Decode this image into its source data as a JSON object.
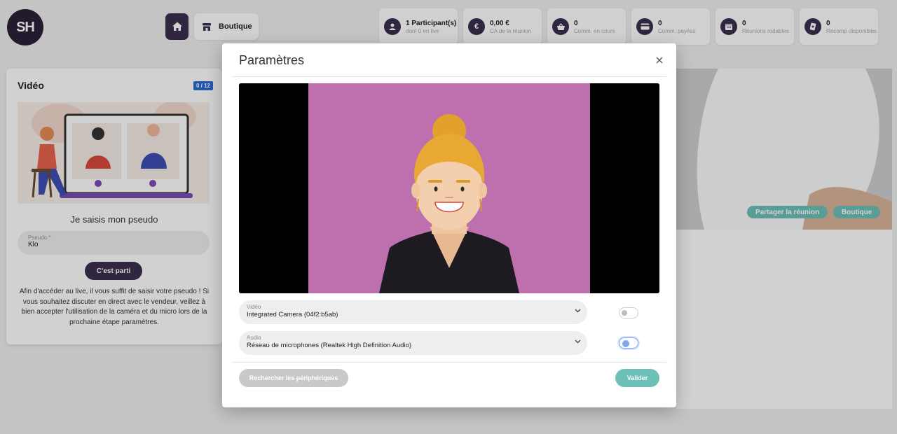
{
  "app": {
    "logo_text": "SH"
  },
  "topnav": {
    "home_label": "",
    "boutique_label": "Boutique"
  },
  "stats": [
    {
      "value": "1 Participant(s)",
      "label": "dont 0 en live",
      "icon": "user-icon"
    },
    {
      "value": "0,00 €",
      "label": "CA de la réunion",
      "icon": "euro-icon"
    },
    {
      "value": "0",
      "label": "Comm. en cours",
      "icon": "basket-icon"
    },
    {
      "value": "0",
      "label": "Comm. payées",
      "icon": "card-icon"
    },
    {
      "value": "0",
      "label": "Réunions rodables",
      "icon": "calendar-icon"
    },
    {
      "value": "0",
      "label": "Récomp disponibles",
      "icon": "reward-icon"
    }
  ],
  "video_card": {
    "title": "Vidéo",
    "badge": "0 / 12",
    "pseudo_heading": "Je saisis mon pseudo",
    "pseudo_label": "Pseudo *",
    "pseudo_value": "Klo",
    "go_button": "C'est parti",
    "help_text": "Afin d'accéder au live, il vous suffit de saisir votre pseudo ! Si vous souhaitez discuter en direct avec le vendeur, veillez à bien accepter l'utilisation de la caméra et du micro lors de la prochaine étape paramètres."
  },
  "side_actions": {
    "share": "Partager la réunion",
    "boutique": "Boutique"
  },
  "modal": {
    "title": "Paramètres",
    "video_label": "Vidéo",
    "video_value": "Integrated Camera (04f2:b5ab)",
    "video_enabled": false,
    "audio_label": "Audio",
    "audio_value": "Réseau de microphones (Realtek High Definition Audio)",
    "audio_enabled": true,
    "search_button": "Rechercher les périphériques",
    "validate_button": "Valider"
  },
  "colors": {
    "brand": "#3b2f4d",
    "accent": "#6dc0b8",
    "badge": "#2d6bd1",
    "preview_bg": "#bd6fae"
  }
}
